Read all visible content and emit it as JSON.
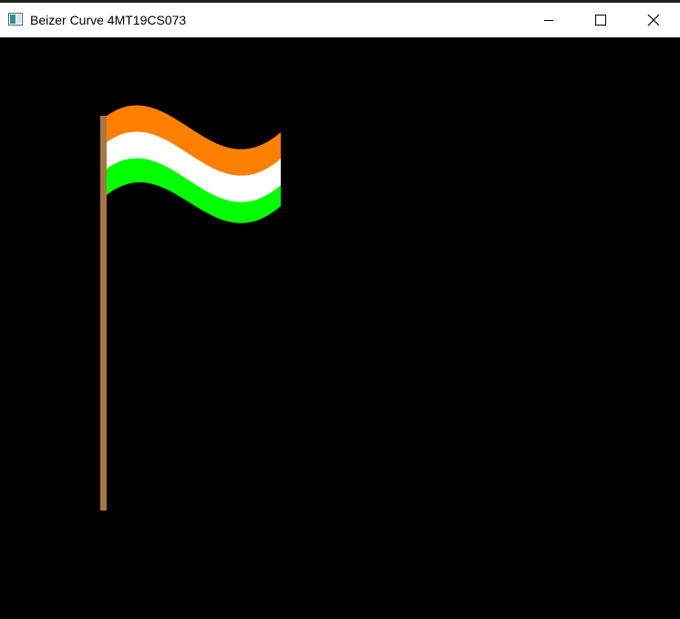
{
  "window": {
    "title": "Beizer Curve 4MT19CS073",
    "app_icon": "application-window-icon",
    "controls": {
      "minimize_icon": "minimize-icon",
      "maximize_icon": "maximize-icon",
      "close_icon": "close-icon"
    }
  },
  "canvas": {
    "background": "#000000",
    "pole_color": "#a87545",
    "stripe_colors": {
      "top": "#ff7f00",
      "middle": "#ffffff",
      "bottom": "#00ff00"
    }
  }
}
